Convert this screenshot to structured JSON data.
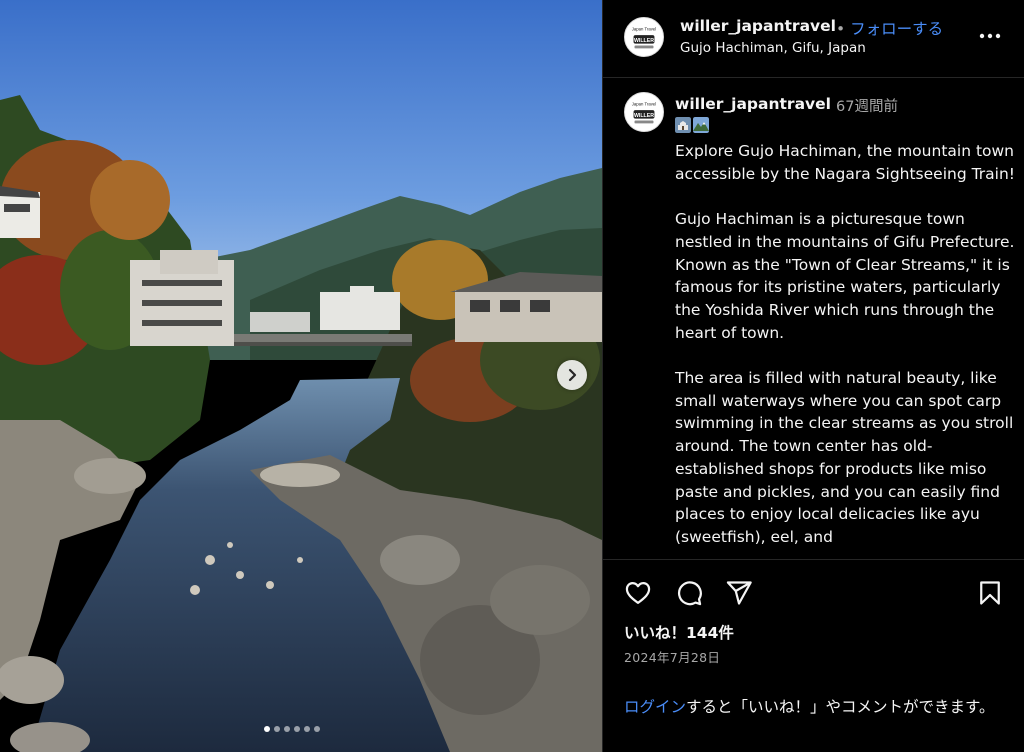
{
  "post": {
    "username": "willer_japantravel",
    "separator": "•",
    "follow_label": "フォローする",
    "location": "Gujo Hachiman, Gifu, Japan",
    "avatar_text_top": "Japan Travel",
    "avatar_text_bottom": "WILLER"
  },
  "caption": {
    "username": "willer_japantravel",
    "time_ago": "67週間前",
    "emoji_icons": [
      "castle-emoji",
      "mountain-photo-emoji"
    ],
    "text": "Explore Gujo Hachiman, the mountain town accessible by the Nagara Sightseeing Train!\n\nGujo Hachiman is a picturesque town nestled in the mountains of Gifu Prefecture. Known as the \"Town of Clear Streams,\" it is famous for its pristine waters, particularly the Yoshida River which runs through the heart of town.\n\nThe area is filled with natural beauty, like small waterways where you can spot carp swimming in the clear streams as you stroll around. The town center has old-established shops for products like miso paste and pickles, and you can easily find places to enjoy local delicacies like ayu (sweetfish), eel, and"
  },
  "actions": {
    "like_icon": "heart-icon",
    "comment_icon": "comment-icon",
    "share_icon": "send-icon",
    "save_icon": "bookmark-icon",
    "likes_text": "いいね！144件",
    "date": "2024年7月28日",
    "login_link": "ログイン",
    "login_rest": "すると「いいね！」やコメントができます。"
  },
  "carousel": {
    "next_icon": "chevron-right-icon",
    "dot_count": 6,
    "active_index": 0
  },
  "colors": {
    "background": "#000000",
    "text": "#f5f5f5",
    "secondary_text": "#a8a8a8",
    "link": "#4a8df8",
    "divider": "#262626"
  }
}
